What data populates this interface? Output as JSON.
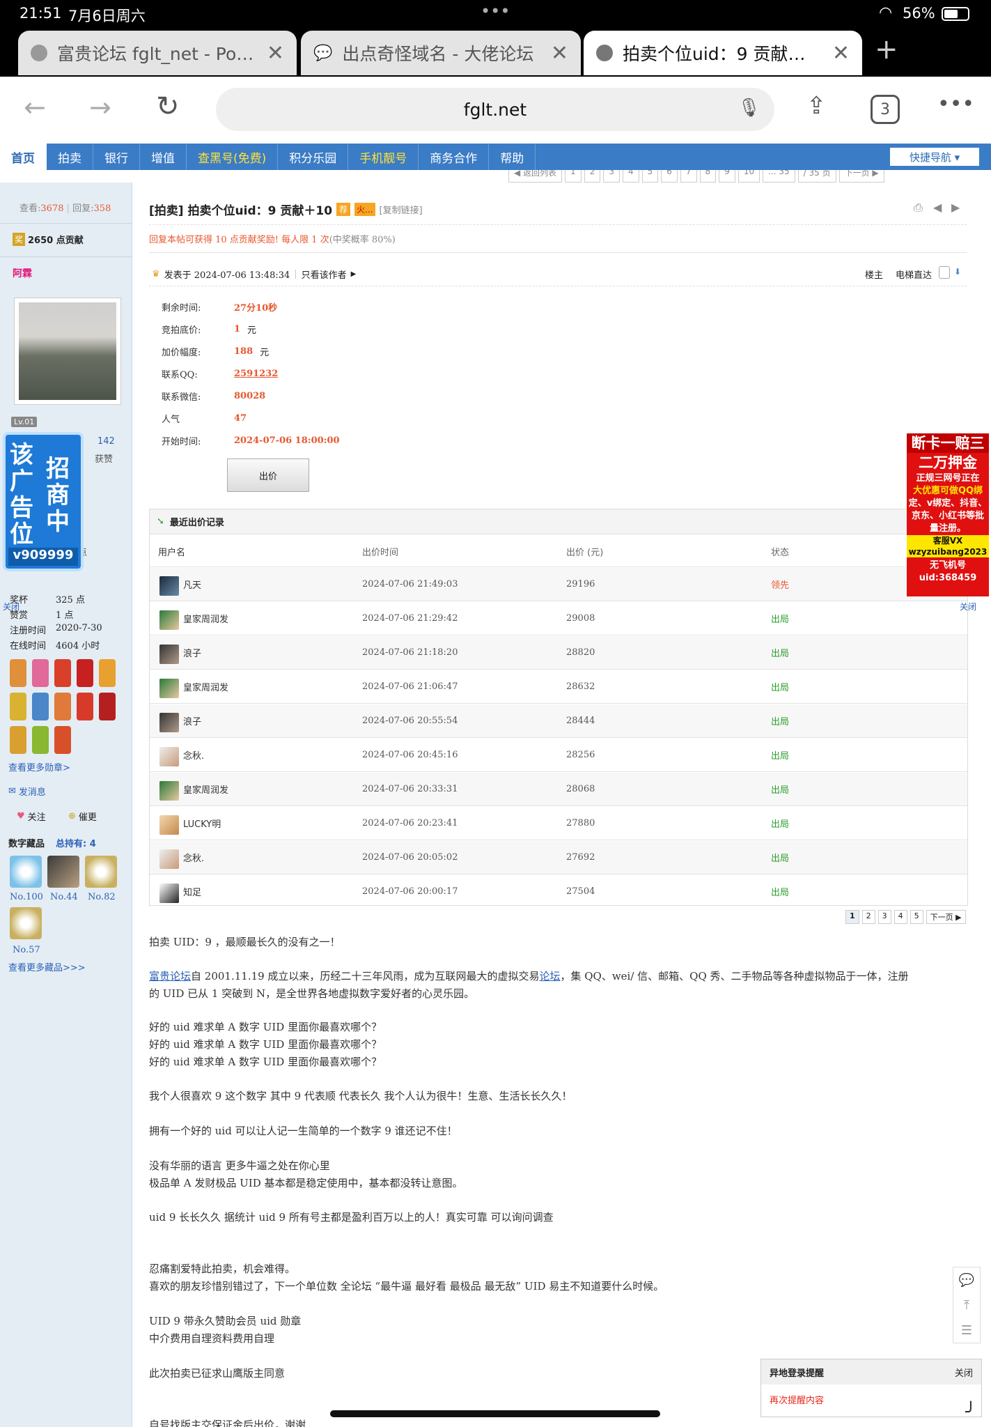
{
  "status": {
    "time": "21:51",
    "date": "7月6日周六",
    "dots": "•••",
    "battery": "56%"
  },
  "tabs": [
    {
      "title": "富贵论坛 fglt_net - Powered",
      "icon": "globe-icon"
    },
    {
      "title": "出点奇怪域名 - 大佬论坛",
      "icon": "chat-icon"
    },
    {
      "title": "拍卖个位uid：9 贡献＋10",
      "icon": "globe-icon"
    }
  ],
  "toolbar": {
    "url": "fglt.net",
    "tab_count": "3",
    "more": "•••"
  },
  "nav": {
    "items": [
      {
        "label": "首页"
      },
      {
        "label": "拍卖"
      },
      {
        "label": "银行"
      },
      {
        "label": "增值"
      },
      {
        "label": "查黑号(免费)"
      },
      {
        "label": "积分乐园"
      },
      {
        "label": "手机靓号"
      },
      {
        "label": "商务合作"
      },
      {
        "label": "帮助"
      }
    ],
    "quick": "快捷导航 ▾"
  },
  "pager_top": {
    "back": "◀ 返回列表",
    "pages": [
      "1",
      "2",
      "3",
      "4",
      "5",
      "6",
      "7",
      "8",
      "9",
      "10",
      "... 35"
    ],
    "total": "/ 35 页",
    "next": "下一页 ▶"
  },
  "sidebar": {
    "views_label": "查看:",
    "views": "3678",
    "replies_label": "回复:",
    "replies": "358",
    "reward_badge": "奖",
    "reward": "2650 点贡献",
    "author": "阿霖",
    "level": "Lv.01",
    "stat_num": "142",
    "stat_label": "获赞",
    "points_partial": "点",
    "ad_text_left": "该广告位",
    "ad_text_right": "招商中",
    "ad_contact": "v909999",
    "close": "关闭",
    "info": [
      {
        "k": "奖杯",
        "v": "325 点"
      },
      {
        "k": "赞赏",
        "v": "1 点"
      },
      {
        "k": "注册时间",
        "v": "2020-7-30"
      },
      {
        "k": "在线时间",
        "v": "4604 小时"
      }
    ],
    "more_medals": "查看更多勋章>",
    "message": "发消息",
    "follow": "关注",
    "urge": "催更",
    "collection_title": "数字藏品",
    "collection_total": "总持有: 4",
    "collection": [
      "No.100",
      "No.44",
      "No.82",
      "No.57"
    ],
    "more_collection": "查看更多藏品>>>"
  },
  "post": {
    "tag": "[拍卖]",
    "title": "拍卖个位uid：9 贡献＋10",
    "badge_recommend": "荐",
    "badge_hot": "火...",
    "copy_link": "[复制链接]",
    "reward_note": "回复本帖可获得 10 点贡献奖励! 每人限 1 次",
    "reward_prob": "(中奖概率 80%)",
    "posted": "发表于 2024-07-06 13:48:34",
    "only_author": "只看该作者",
    "floor": "楼主",
    "elevator": "电梯直达",
    "fields": [
      {
        "k": "剩余时间:",
        "v": "27分10秒",
        "u": ""
      },
      {
        "k": "竞拍底价:",
        "v": "1",
        "u": "元"
      },
      {
        "k": "加价幅度:",
        "v": "188",
        "u": "元"
      },
      {
        "k": "联系QQ:",
        "v": "2591232",
        "u": ""
      },
      {
        "k": "联系微信:",
        "v": "80028",
        "u": ""
      },
      {
        "k": "人气",
        "v": "47",
        "u": ""
      },
      {
        "k": "开始时间:",
        "v": "2024-07-06 18:00:00",
        "u": ""
      }
    ],
    "bid_button": "出价"
  },
  "bids": {
    "title": "最近出价记录",
    "headers": [
      "用户名",
      "出价时间",
      "出价 (元)",
      "状态"
    ],
    "rows": [
      {
        "user": "凡天",
        "time": "2024-07-06 21:49:03",
        "price": "29196",
        "status": "领先"
      },
      {
        "user": "皇家周润发",
        "time": "2024-07-06 21:29:42",
        "price": "29008",
        "status": "出局"
      },
      {
        "user": "浪子",
        "time": "2024-07-06 21:18:20",
        "price": "28820",
        "status": "出局"
      },
      {
        "user": "皇家周润发",
        "time": "2024-07-06 21:06:47",
        "price": "28632",
        "status": "出局"
      },
      {
        "user": "浪子",
        "time": "2024-07-06 20:55:54",
        "price": "28444",
        "status": "出局"
      },
      {
        "user": "念秋.",
        "time": "2024-07-06 20:45:16",
        "price": "28256",
        "status": "出局"
      },
      {
        "user": "皇家周润发",
        "time": "2024-07-06 20:33:31",
        "price": "28068",
        "status": "出局"
      },
      {
        "user": "LUCKY明",
        "time": "2024-07-06 20:23:41",
        "price": "27880",
        "status": "出局"
      },
      {
        "user": "念秋.",
        "time": "2024-07-06 20:05:02",
        "price": "27692",
        "status": "出局"
      },
      {
        "user": "知足",
        "time": "2024-07-06 20:00:17",
        "price": "27504",
        "status": "出局"
      }
    ],
    "pager": [
      "1",
      "2",
      "3",
      "4",
      "5"
    ],
    "pager_next": "下一页 ▶"
  },
  "content": {
    "lines": [
      "拍卖 UID：9 ，最顺最长久的没有之一！",
      "",
      "自 2001.11.19 成立以来，历经二十三年风雨，成为互联网最大的虚拟交易",
      "的 UID 已从 1 突破到 N，是全世界各地虚拟数字爱好者的心灵乐园。",
      "好的 uid 难求单 A 数字 UID 里面你最喜欢哪个？",
      "好的 uid 难求单 A 数字 UID 里面你最喜欢哪个？",
      "好的 uid 难求单 A 数字 UID 里面你最喜欢哪个？",
      "我个人很喜欢 9 这个数字 其中 9 代表顺 代表长久 我个人认为很牛！生意、生活长长久久！",
      "拥有一个好的 uid 可以让人记一生简单的一个数字 9 谁还记不住！",
      "没有华丽的语言 更多牛逼之处在你心里",
      "极品单 A 发财极品 UID 基本都是稳定使用中，基本都没转让意图。",
      "uid 9 长长久久 据统计 uid 9 所有号主都是盈利百万以上的人！真实可靠 可以询问调查",
      "忍痛割爱特此拍卖，机会难得。",
      "喜欢的朋友珍惜别错过了，下一个单位数 全论坛 “最牛逼 最好看 最极品 最无敌” UID 易主不知道要什么时候。",
      "UID 9 带永久赞助会员 uid 勋章",
      "中介费用自理资料费用自理",
      "此次拍卖已征求山鹰版主同意",
      "自号找版主交保证金后出价，谢谢"
    ],
    "link_forum": "富贵论坛",
    "link_luntan": "论坛",
    "line3_tail": "，集 QQ、wei/ 信、邮箱、QQ 秀、二手物品等各种虚拟物品于一体，注册"
  },
  "right_ad": {
    "l1": "断卡一赔三",
    "l2": "二万押金",
    "l3": "正规三网号正在",
    "l4": "大优惠可做QQ绑",
    "l5": "定、v绑定、抖音、",
    "l6": "京东、小红书等批",
    "l7": "量注册。",
    "l8": "客服VX",
    "l9": "wzyzuibang2023",
    "l10": "无飞机号",
    "l11": "uid:368459",
    "close": "关闭"
  },
  "login_alert": {
    "title": "异地登录提醒",
    "close": "关闭",
    "link": "再次提醒内容"
  },
  "colors": {
    "nav": "#3b7cc6",
    "accent_red": "#e8572e",
    "green": "#2a9d2a",
    "sidebar": "#e5edf4"
  }
}
